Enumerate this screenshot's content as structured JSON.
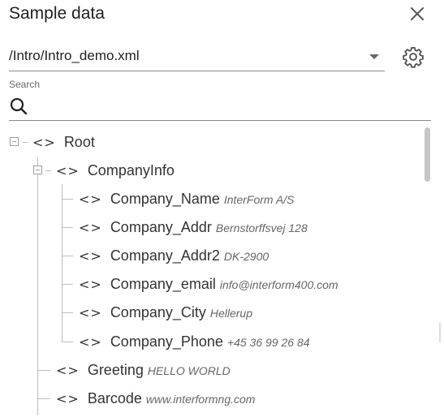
{
  "header": {
    "title": "Sample data"
  },
  "file_select": {
    "value": "/Intro/Intro_demo.xml"
  },
  "search": {
    "label": "Search",
    "value": ""
  },
  "tree": {
    "root": {
      "name": "Root"
    },
    "company_info": {
      "name": "CompanyInfo",
      "children": [
        {
          "name": "Company_Name",
          "value": "InterForm A/S"
        },
        {
          "name": "Company_Addr",
          "value": "Bernstorffsvej 128"
        },
        {
          "name": "Company_Addr2",
          "value": "DK-2900"
        },
        {
          "name": "Company_email",
          "value": "info@interform400.com"
        },
        {
          "name": "Company_City",
          "value": "Hellerup"
        },
        {
          "name": "Company_Phone",
          "value": "+45 36 99 26 84"
        }
      ]
    },
    "greeting": {
      "name": "Greeting",
      "value": "HELLO WORLD"
    },
    "barcode": {
      "name": "Barcode",
      "value": "www.interformng.com"
    }
  },
  "icons": {
    "close": "close-icon",
    "settings": "gear-icon",
    "search": "search-icon",
    "dropdown": "chevron-down-icon",
    "element": "code-tag-icon",
    "collapse": "collapse-box-icon"
  }
}
